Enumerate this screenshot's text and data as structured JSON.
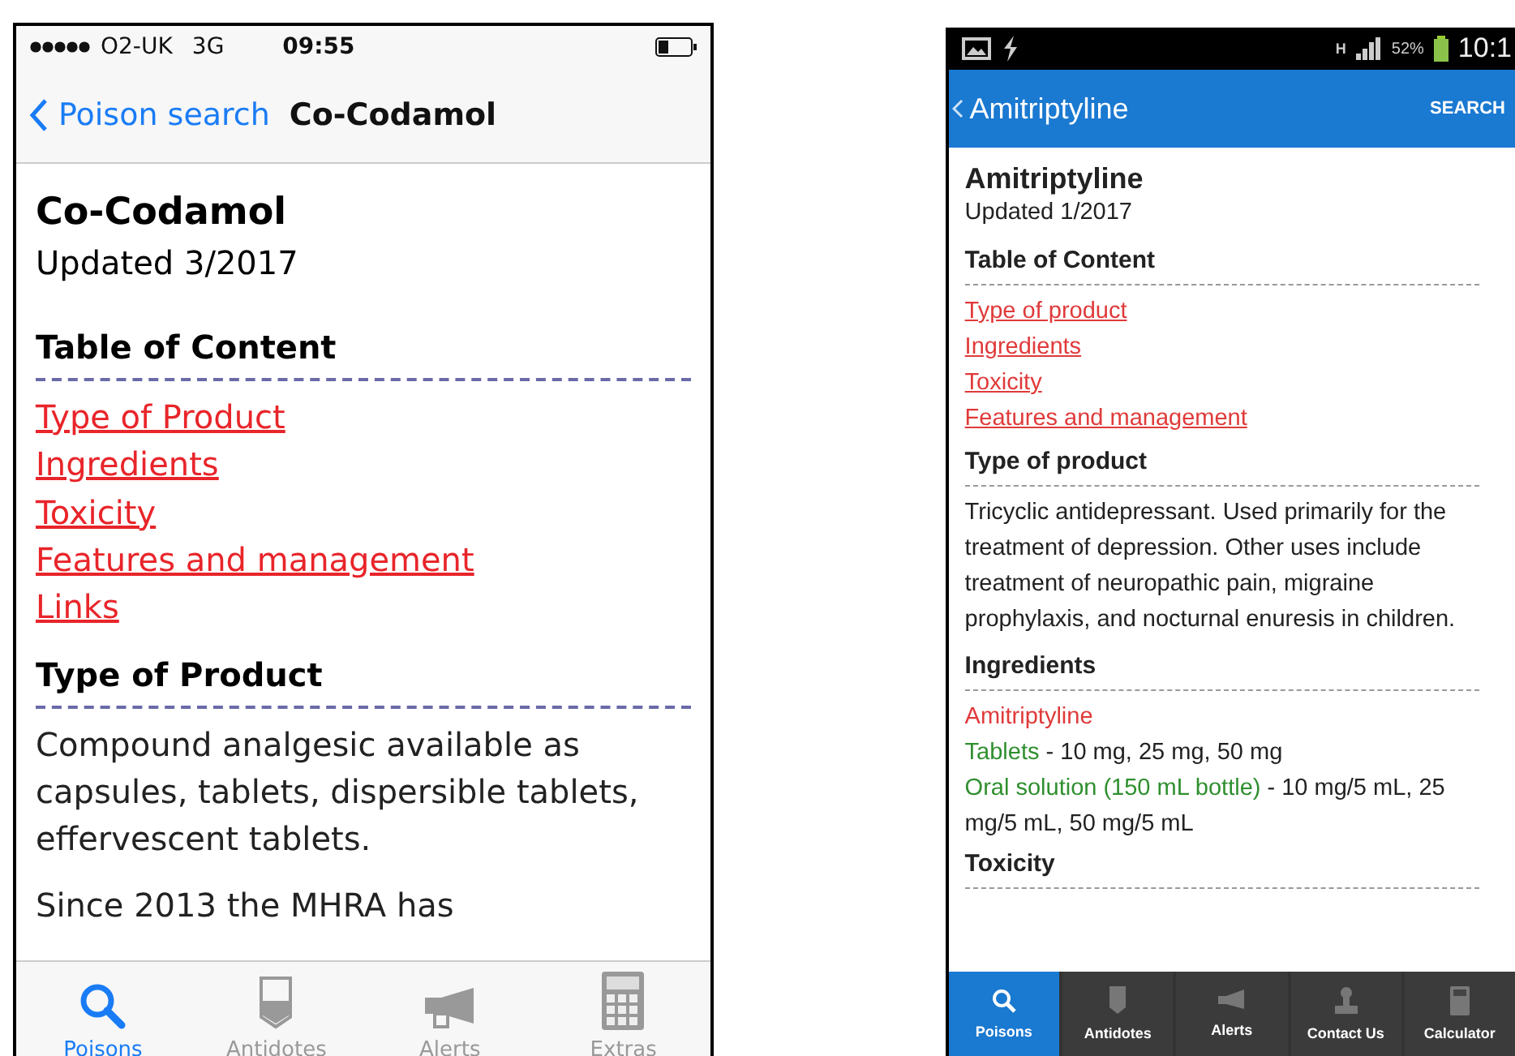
{
  "ios_screen": {
    "status_bar": {
      "carrier": "O2-UK",
      "network": "3G",
      "time": "09:55"
    },
    "nav_bar": {
      "back": "Poison search",
      "title": "Co-Codamol"
    },
    "heading": "Co-Codamol",
    "updated": "Updated 3/2017",
    "sections": [
      {
        "title": "Table of Content",
        "links": [
          "Type of Product",
          "Ingredients",
          "Toxicity",
          "Features and management",
          "Links"
        ]
      },
      {
        "title": "Type of Product",
        "paragraphs": [
          "Compound analgesic available as capsules, tablets, dispersible tablets, effervescent tablets.",
          "Since 2013 the MHRA has"
        ]
      }
    ],
    "tabs": [
      {
        "label": "Poisons",
        "selected": true
      },
      {
        "label": "Antidotes",
        "selected": false
      },
      {
        "label": "Alerts",
        "selected": false
      },
      {
        "label": "Extras",
        "selected": false
      }
    ]
  },
  "android_screen": {
    "status_bar": {
      "network": "H",
      "battery": "52%",
      "time": "10:1"
    },
    "action_bar": {
      "back": "Amitriptyline",
      "action": "SEARCH"
    },
    "heading": "Amitriptyline",
    "updated": "Updated 1/2017",
    "sections": [
      {
        "title": "Table of Content",
        "links": [
          "Type of product",
          "Ingredients",
          "Toxicity",
          "Features and management"
        ]
      },
      {
        "title": "Type of product",
        "paragraphs": [
          "Tricyclic antidepressant. Used primarily for the treatment of depression. Other uses include treatment of neuropathic pain, migraine prophylaxis, and nocturnal enuresis in children."
        ]
      },
      {
        "title": "Ingredients",
        "items": [
          {
            "kind": "drug",
            "name": "Amitriptyline"
          },
          {
            "kind": "form",
            "name": "Tablets",
            "detail": " - 10 mg, 25 mg, 50 mg"
          },
          {
            "kind": "form",
            "name": "Oral solution (150 mL bottle)",
            "detail": " - 10 mg/5 mL, 25 mg/5 mL, 50 mg/5 mL"
          }
        ]
      },
      {
        "title": "Toxicity"
      }
    ],
    "tabs": [
      {
        "label": "Poisons",
        "selected": true
      },
      {
        "label": "Antidotes",
        "selected": false
      },
      {
        "label": "Alerts",
        "selected": false
      },
      {
        "label": "Contact Us",
        "selected": false
      },
      {
        "label": "Calculator",
        "selected": false
      }
    ]
  }
}
